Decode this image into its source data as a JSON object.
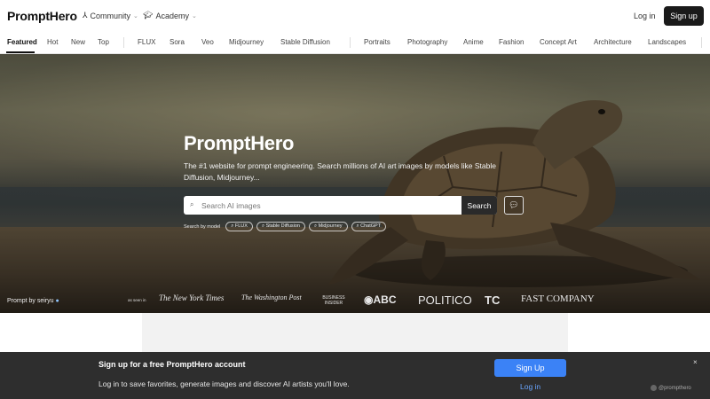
{
  "header": {
    "logo": "PromptHero",
    "community_label": "Community",
    "academy_label": "Academy",
    "login_label": "Log in",
    "signup_label": "Sign up"
  },
  "tabs": {
    "featured": "Featured",
    "hot": "Hot",
    "new": "New",
    "top": "Top",
    "flux": "FLUX",
    "sora": "Sora",
    "veo": "Veo",
    "midjourney": "Midjourney",
    "stable_diffusion": "Stable Diffusion",
    "portraits": "Portraits",
    "photography": "Photography",
    "anime": "Anime",
    "fashion": "Fashion",
    "concept_art": "Concept Art",
    "architecture": "Architecture",
    "landscapes": "Landscapes"
  },
  "hero": {
    "title": "PromptHero",
    "subtitle": "The #1 website for prompt engineering. Search millions of AI art images by models like Stable Diffusion, Midjourney...",
    "search_placeholder": "Search AI images",
    "search_button": "Search",
    "search_by_model_label": "Search by model",
    "model_chips": [
      "FLUX",
      "Stable Diffusion",
      "Midjourney",
      "ChatGPT"
    ],
    "prompt_by": "Prompt by seiryu",
    "as_seen_in": "as seen in",
    "press": {
      "nyt": "The New York Times",
      "wapo": "The Washington Post",
      "bi": "BUSINESS INSIDER",
      "abc": "ABC",
      "politico": "POLITICO",
      "tc": "TC",
      "fastco": "FAST COMPANY"
    }
  },
  "banner": {
    "title": "Sign up for a free PromptHero account",
    "text": "Log in to save favorites, generate images and discover AI artists you'll love.",
    "signup_label": "Sign Up",
    "login_label": "Log in",
    "close": "×",
    "attribution": "@prompthero"
  },
  "colors": {
    "primary_button": "#3b82f6",
    "banner_bg": "#2e2e2e",
    "dark_button": "#1a1a1a"
  }
}
